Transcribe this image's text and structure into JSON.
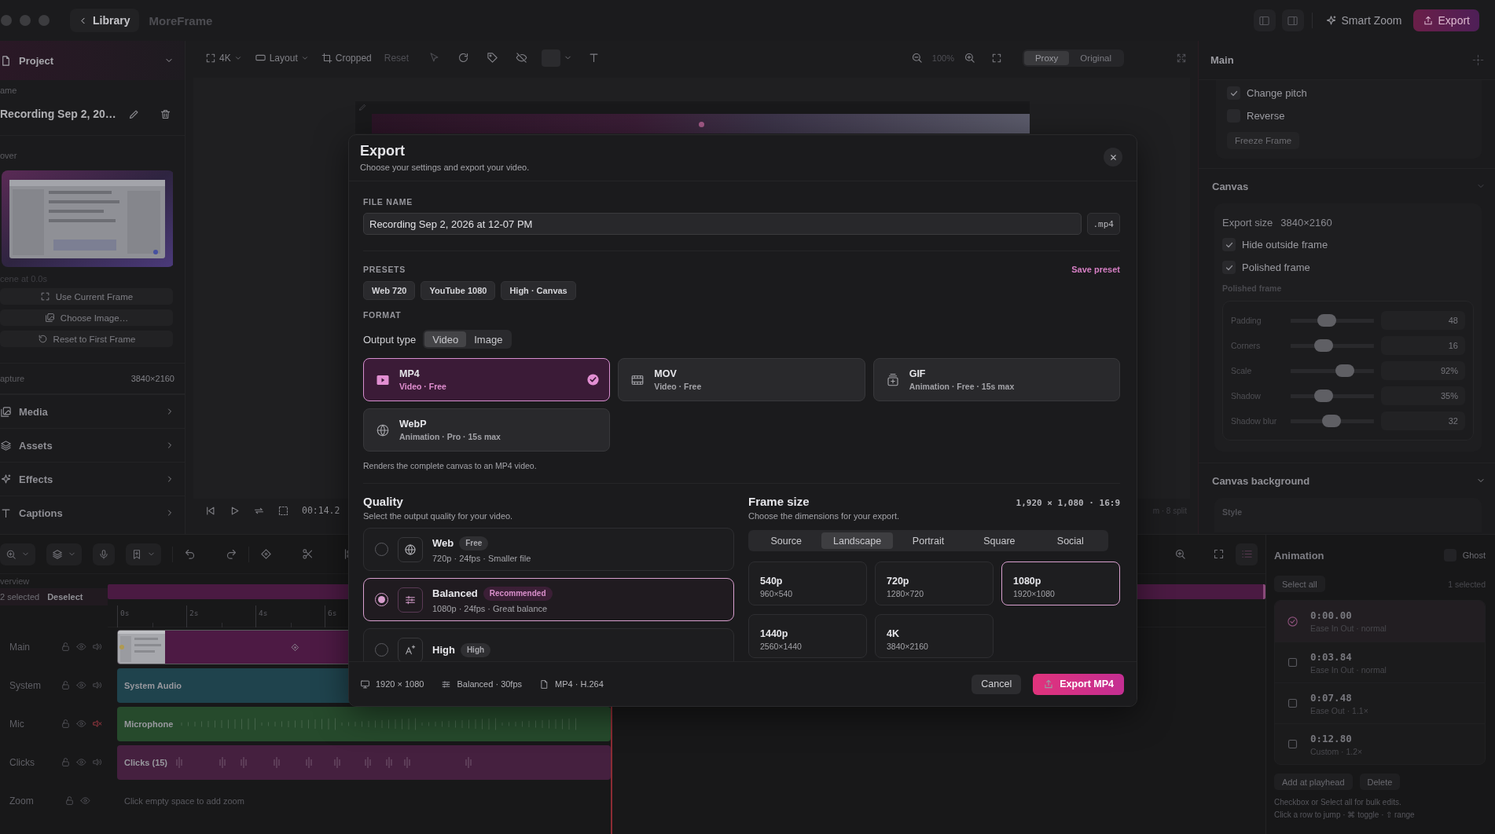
{
  "titlebar": {
    "back": "Library",
    "app_name": "MoreFrame",
    "smart_zoom": "Smart Zoom",
    "export": "Export"
  },
  "sidebar": {
    "project": "Project",
    "name_label": "ame",
    "name": "Recording Sep 2, 20…",
    "cover_label": "over",
    "cover_caption": "cene at 0.0s",
    "cover_actions": [
      "Use Current Frame",
      "Choose Image…",
      "Reset to First Frame"
    ],
    "capture_label": "apture",
    "capture_value": "3840×2160",
    "sections": [
      {
        "label": "Media"
      },
      {
        "label": "Assets"
      },
      {
        "label": "Effects"
      },
      {
        "label": "Captions"
      }
    ]
  },
  "canvas_toolbar": {
    "resolution": "4K",
    "layout": "Layout",
    "crop": "Cropped",
    "reset": "Reset",
    "zoom": "100%",
    "view_modes": [
      {
        "label": "Proxy",
        "selected": true
      },
      {
        "label": "Original",
        "selected": false
      }
    ]
  },
  "playback": {
    "time": "00:14.2",
    "info": "m · 8 split"
  },
  "inspector": {
    "title": "Main",
    "options": [
      {
        "label": "Change pitch",
        "checked": true
      },
      {
        "label": "Reverse",
        "checked": false
      }
    ],
    "freeze": "Freeze Frame",
    "canvas": {
      "title": "Canvas",
      "export_size_label": "Export size",
      "export_size": "3840×2160",
      "options": [
        {
          "label": "Hide outside frame",
          "checked": true
        },
        {
          "label": "Polished frame",
          "checked": true
        }
      ],
      "group_label": "Polished frame",
      "sliders": [
        {
          "label": "Padding",
          "level": 0.41,
          "value": "48"
        },
        {
          "label": "Corners",
          "level": 0.36,
          "value": "16"
        },
        {
          "label": "Scale",
          "level": 0.69,
          "value": "92%"
        },
        {
          "label": "Shadow",
          "level": 0.37,
          "value": "35%"
        },
        {
          "label": "Shadow blur",
          "level": 0.49,
          "value": "32"
        }
      ]
    },
    "background": {
      "title": "Canvas background",
      "style_label": "Style"
    }
  },
  "timeline": {
    "overview": "verview",
    "selection": "2 selected",
    "deselect": "Deselect",
    "ruler": [
      "0s",
      "2s",
      "4s",
      "6s"
    ],
    "tracks": [
      {
        "name": "Main",
        "kind": "video",
        "muted": false,
        "color": "#4d1a44"
      },
      {
        "name": "System",
        "kind": "audio",
        "muted": false,
        "clip": "System Audio",
        "color": "#1f434d",
        "waveform": false
      },
      {
        "name": "Mic",
        "kind": "audio",
        "muted": true,
        "clip": "Microphone",
        "color": "#264a2c",
        "waveform": true
      },
      {
        "name": "Clicks",
        "kind": "clicks",
        "muted": false,
        "clip": "Clicks (15)",
        "color": "#45203f"
      },
      {
        "name": "Zoom",
        "kind": "zoom",
        "hint": "Click empty space to add zoom"
      }
    ]
  },
  "animation": {
    "title": "Animation",
    "ghost": {
      "label": "Ghost",
      "checked": false
    },
    "select_all": "Select all",
    "count": "1 selected",
    "keyframes": [
      {
        "time": "0:00.00",
        "easing": "Ease In Out · normal",
        "selected": true
      },
      {
        "time": "0:03.84",
        "easing": "Ease In Out · normal",
        "selected": false
      },
      {
        "time": "0:07.48",
        "easing": "Ease Out · 1.1×",
        "selected": false
      },
      {
        "time": "0:12.80",
        "easing": "Custom · 1.2×",
        "selected": false
      }
    ],
    "actions": [
      "Add at playhead",
      "Delete"
    ],
    "hints": [
      "Checkbox or Select all for bulk edits.",
      "Click a row to jump · ⌘ toggle · ⇧ range"
    ]
  },
  "export_dialog": {
    "title": "Export",
    "subtitle": "Choose your settings and export your video.",
    "file_name_label": "FILE NAME",
    "file_name": "Recording Sep 2, 2026 at 12-07 PM",
    "extension": ".mp4",
    "presets_label": "PRESETS",
    "save_preset": "Save preset",
    "presets": [
      "Web 720",
      "YouTube 1080",
      "High · Canvas"
    ],
    "format_label": "FORMAT",
    "output_type_label": "Output type",
    "output_types": [
      {
        "label": "Video",
        "selected": true
      },
      {
        "label": "Image",
        "selected": false
      }
    ],
    "formats": [
      {
        "name": "MP4",
        "detail": "Video · Free",
        "selected": true
      },
      {
        "name": "MOV",
        "detail": "Video · Free",
        "selected": false
      },
      {
        "name": "GIF",
        "detail": "Animation · Free · 15s max",
        "selected": false
      },
      {
        "name": "WebP",
        "detail": "Animation · Pro · 15s max",
        "selected": false
      }
    ],
    "format_note": "Renders the complete canvas to an MP4 video.",
    "quality": {
      "title": "Quality",
      "subtitle": "Select the output quality for your video.",
      "options": [
        {
          "name": "Web",
          "badge": "Free",
          "detail": "720p · 24fps · Smaller file",
          "selected": false
        },
        {
          "name": "Balanced",
          "badge": "Recommended",
          "detail": "1080p · 24fps · Great balance",
          "selected": true
        },
        {
          "name": "High",
          "badge": "High",
          "selected": false
        }
      ]
    },
    "frame_size": {
      "title": "Frame size",
      "summary": "1,920 × 1,080 · 16:9",
      "subtitle": "Choose the dimensions for your export.",
      "tabs": [
        {
          "label": "Source",
          "selected": false
        },
        {
          "label": "Landscape",
          "selected": true
        },
        {
          "label": "Portrait",
          "selected": false
        },
        {
          "label": "Square",
          "selected": false
        },
        {
          "label": "Social",
          "selected": false
        }
      ],
      "sizes": [
        {
          "name": "540p",
          "detail": "960×540",
          "selected": false
        },
        {
          "name": "720p",
          "detail": "1280×720",
          "selected": false
        },
        {
          "name": "1080p",
          "detail": "1920×1080",
          "selected": true
        },
        {
          "name": "1440p",
          "detail": "2560×1440",
          "selected": false
        },
        {
          "name": "4K",
          "detail": "3840×2160",
          "selected": false
        }
      ]
    },
    "footer": {
      "resolution": "1920 × 1080",
      "quality": "Balanced · 30fps",
      "format": "MP4 · H.264"
    },
    "cancel": "Cancel",
    "export": "Export MP4"
  }
}
